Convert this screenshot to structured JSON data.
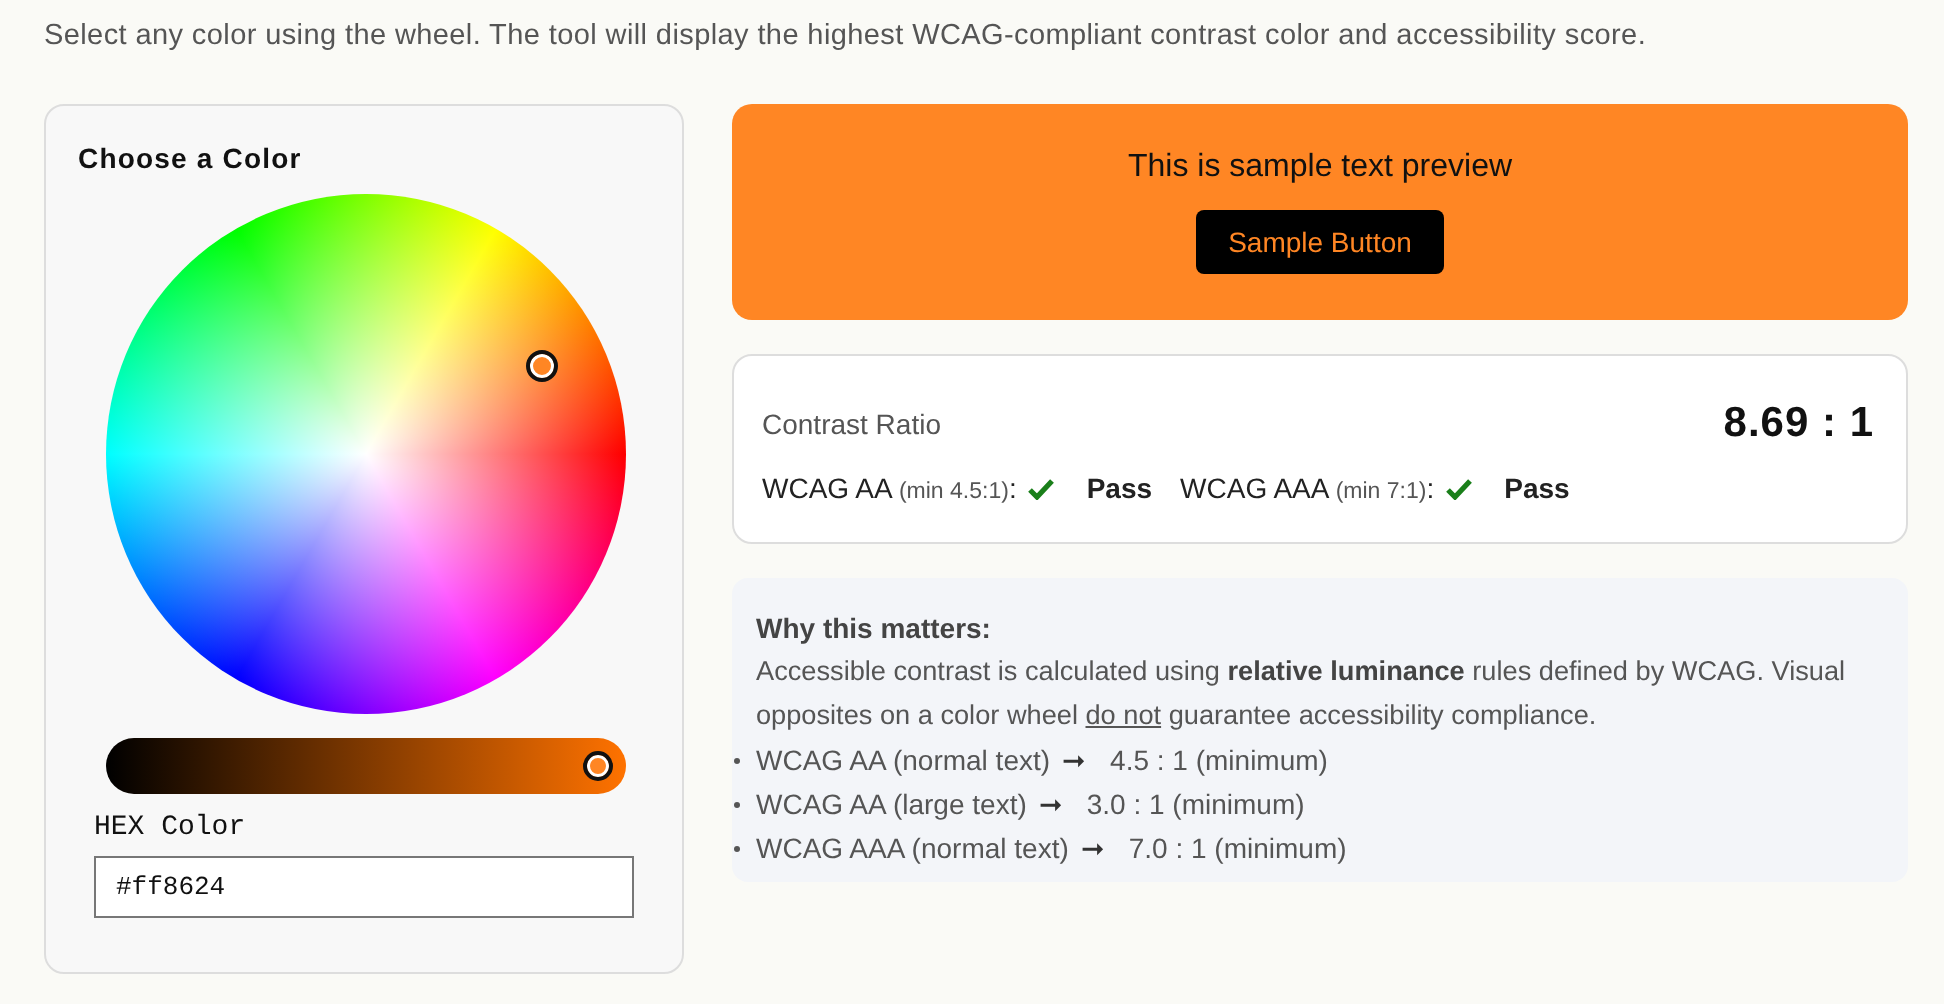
{
  "intro": "Select any color using the wheel. The tool will display the highest WCAG-compliant contrast color and accessibility score.",
  "picker": {
    "title": "Choose a Color",
    "brightness": {
      "level": 1
    },
    "hex_label": "HEX Color",
    "hex_value": "#ff8624"
  },
  "preview": {
    "text": "This is sample text preview",
    "button": "Sample Button"
  },
  "contrast": {
    "label": "Contrast Ratio",
    "ratio": "8.69 : 1",
    "checks": [
      {
        "name": "WCAG AA",
        "min": "(min 4.5:1)",
        "separator": ":",
        "passed": true,
        "result": "Pass"
      },
      {
        "name": "WCAG AAA",
        "min": "(min 7:1)",
        "separator": ":",
        "passed": true,
        "result": "Pass"
      }
    ]
  },
  "info": {
    "title": "Why this matters:",
    "paragraph": [
      {
        "kind": "plain",
        "text": "Accessible contrast is calculated using "
      },
      {
        "kind": "bold",
        "text": "relative luminance"
      },
      {
        "kind": "plain",
        "text": " rules defined by WCAG. Visual opposites on a color wheel "
      },
      {
        "kind": "underline",
        "text": "do not"
      },
      {
        "kind": "plain",
        "text": " guarantee accessibility compliance."
      }
    ],
    "items": [
      {
        "label": "WCAG AA (normal text)",
        "arrow": "➞",
        "value": "4.5 : 1 (minimum)"
      },
      {
        "label": "WCAG AA (large text)",
        "arrow": "➞",
        "value": "3.0 : 1 (minimum)"
      },
      {
        "label": "WCAG AAA (normal text)",
        "arrow": "➞",
        "value": "7.0 : 1 (minimum)"
      }
    ]
  }
}
